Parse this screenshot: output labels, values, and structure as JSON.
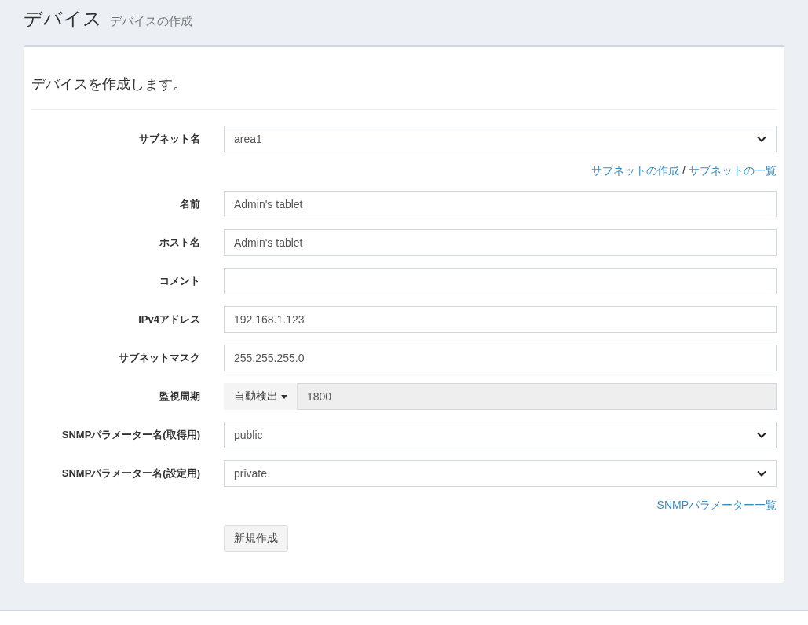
{
  "header": {
    "title": "デバイス",
    "subtitle": "デバイスの作成"
  },
  "lead": "デバイスを作成します。",
  "fields": [
    {
      "kind": "select",
      "label": "サブネット名",
      "value": "area1"
    },
    {
      "kind": "links",
      "links": [
        "サブネットの作成",
        "サブネットの一覧"
      ],
      "separator": "/"
    },
    {
      "kind": "input",
      "label": "名前",
      "value": "Admin's tablet"
    },
    {
      "kind": "input",
      "label": "ホスト名",
      "value": "Admin's tablet"
    },
    {
      "kind": "input",
      "label": "コメント"
    },
    {
      "kind": "input",
      "label": "IPv4アドレス",
      "value": "192.168.1.123"
    },
    {
      "kind": "input",
      "label": "サブネットマスク",
      "value": "255.255.255.0"
    },
    {
      "kind": "addon",
      "label": "監視周期",
      "addon": "自動検出",
      "value": "1800",
      "disabled": true
    },
    {
      "kind": "select",
      "label": "SNMPパラメーター名(取得用)",
      "value": "public"
    },
    {
      "kind": "select",
      "label": "SNMPパラメーター名(設定用)",
      "value": "private"
    },
    {
      "kind": "links",
      "links": [
        "SNMPパラメーター一覧"
      ]
    }
  ],
  "submit": "新規作成"
}
